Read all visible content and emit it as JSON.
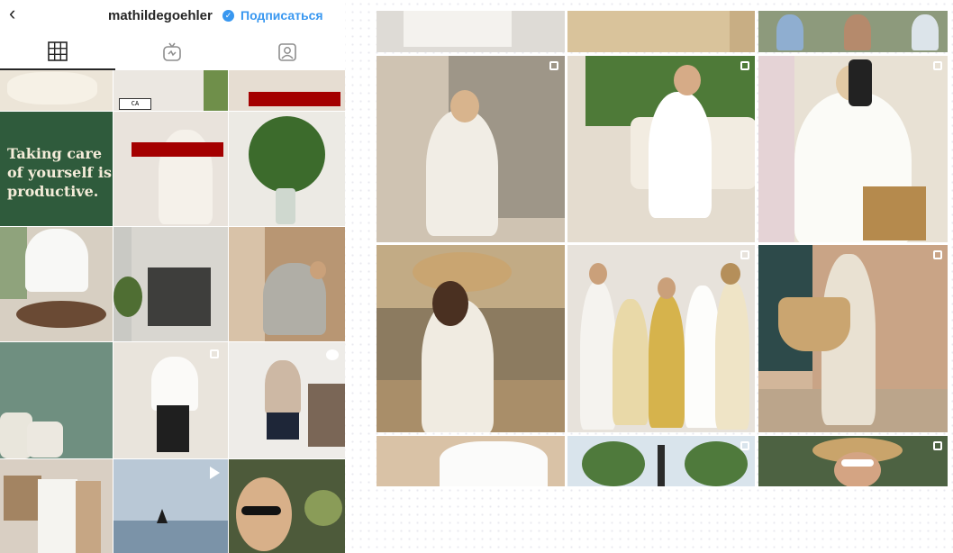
{
  "profile": {
    "back_icon": "chevron-left-icon",
    "username": "mathildegoehler",
    "verified_icon": "verified-badge-icon",
    "follow_label": "Подписаться"
  },
  "tabs": [
    {
      "name": "posts-grid",
      "icon": "grid-icon",
      "active": true
    },
    {
      "name": "igtv",
      "icon": "igtv-icon",
      "active": false
    },
    {
      "name": "tagged",
      "icon": "tagged-user-icon",
      "active": false
    }
  ],
  "posts": {
    "quote_text": "Taking care of yourself is productive.",
    "car_plate": "CA 235·456"
  },
  "colors": {
    "accent": "#3897f0",
    "quote_bg": "#2f5b3c",
    "quote_text": "#f4ecd9",
    "censor_bar": "#a40000"
  }
}
